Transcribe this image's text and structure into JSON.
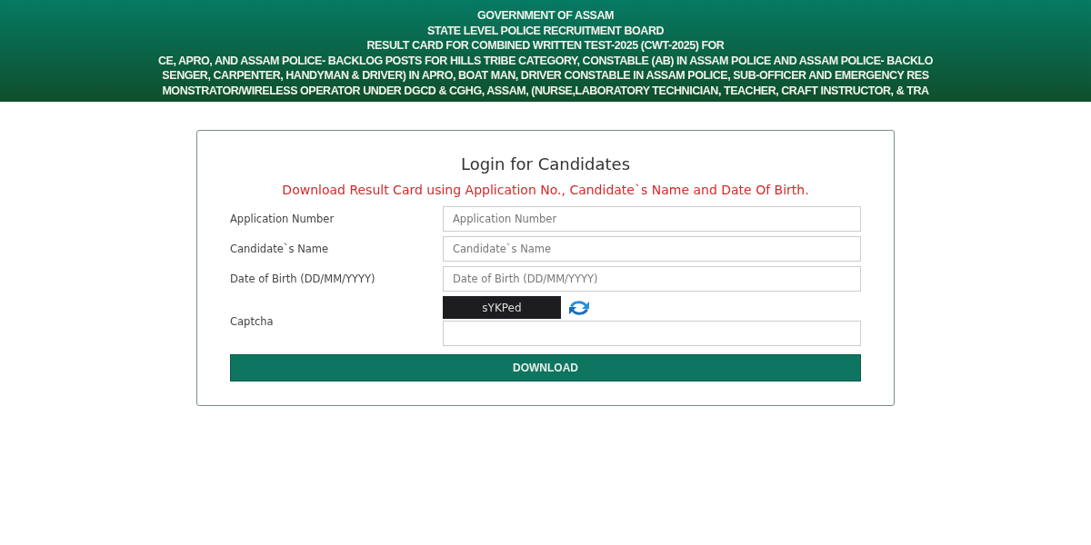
{
  "header": {
    "lines": [
      "GOVERNMENT OF ASSAM",
      "STATE LEVEL POLICE RECRUITMENT BOARD",
      "RESULT CARD FOR COMBINED WRITTEN TEST-2025 (CWT-2025) FOR",
      "CE, APRO, AND ASSAM POLICE- BACKLOG POSTS FOR HILLS TRIBE CATEGORY, CONSTABLE (AB) IN ASSAM POLICE AND ASSAM POLICE- BACKLO",
      "SENGER, CARPENTER, HANDYMAN & DRIVER) IN APRO, BOAT MAN, DRIVER CONSTABLE IN ASSAM POLICE, SUB-OFFICER AND EMERGENCY RES",
      "MONSTRATOR/WIRELESS OPERATOR UNDER DGCD & CGHG, ASSAM, (NURSE,LABORATORY TECHNICIAN, TEACHER, CRAFT INSTRUCTOR, & TRA"
    ]
  },
  "login": {
    "title": "Login for Candidates",
    "notice": "Download Result Card using Application No., Candidate`s Name and Date Of Birth.",
    "fields": [
      {
        "kind": "text",
        "label": "Application Number",
        "placeholder": "Application Number"
      },
      {
        "kind": "text",
        "label": "Candidate`s Name",
        "placeholder": "Candidate`s Name"
      },
      {
        "kind": "text",
        "label": "Date of Birth (DD/MM/YYYY)",
        "placeholder": "Date of Birth (DD/MM/YYYY)"
      },
      {
        "kind": "captcha",
        "label": "Captcha",
        "captcha": "sYKPed"
      }
    ],
    "button": "DOWNLOAD"
  }
}
